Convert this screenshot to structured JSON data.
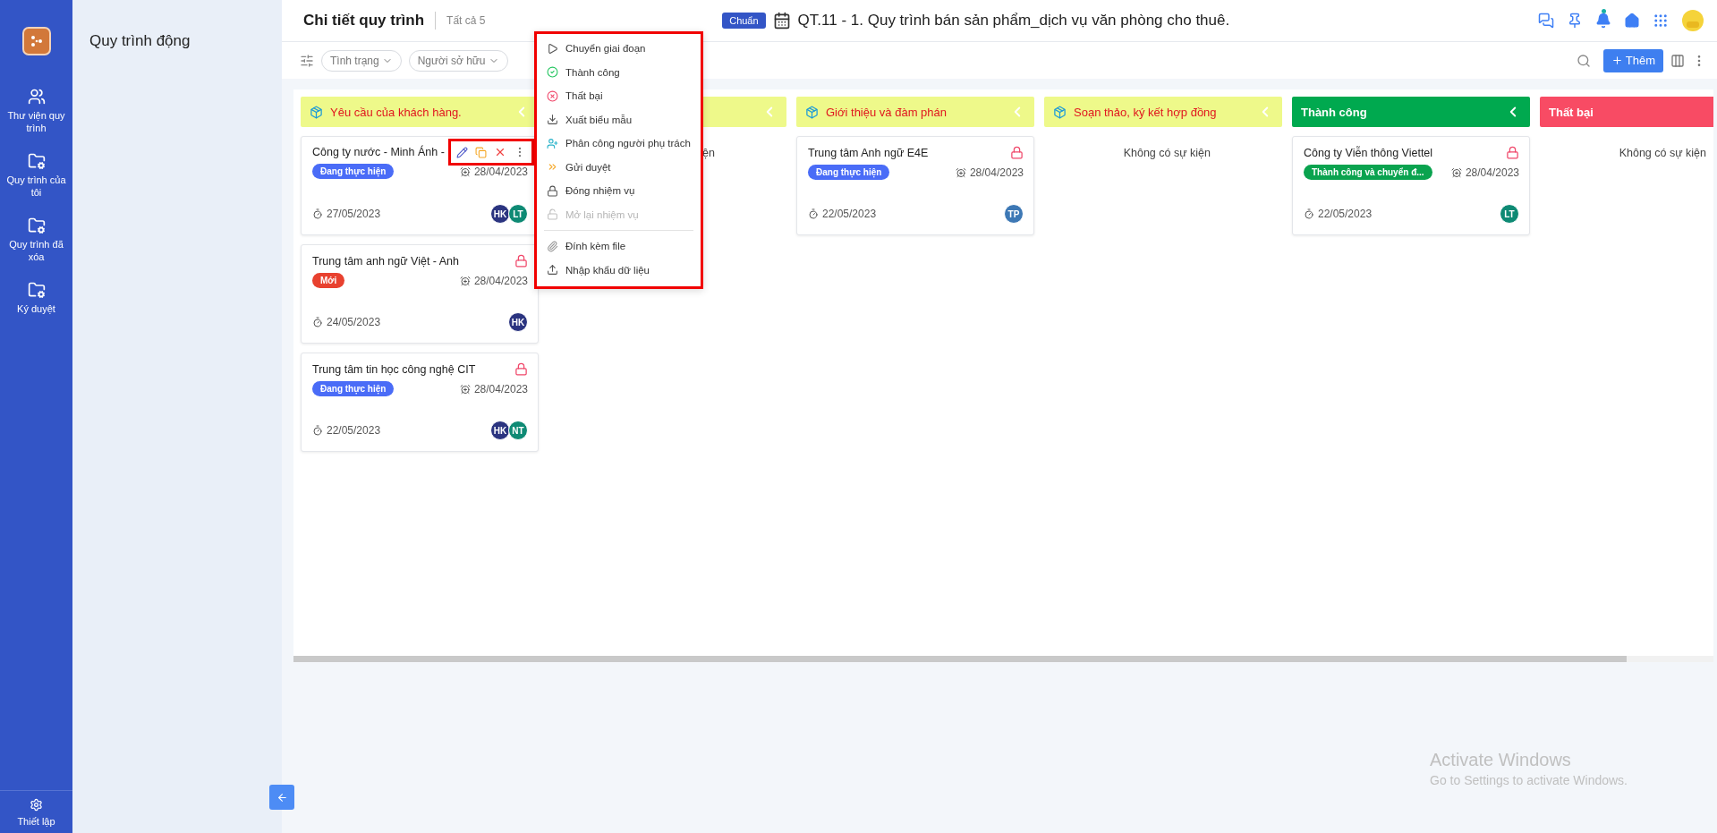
{
  "sidebar": {
    "items": [
      {
        "label": "Thư viện quy trình"
      },
      {
        "label": "Quy trình của tôi"
      },
      {
        "label": "Quy trình đã xóa"
      },
      {
        "label": "Ký duyệt"
      }
    ],
    "footer": {
      "label": "Thiết lập"
    }
  },
  "subpanel": {
    "title": "Quy trình động"
  },
  "header": {
    "title": "Chi tiết quy trình",
    "count": "Tất cả 5",
    "badge": "Chuẩn",
    "process_title": "QT.11 - 1. Quy trình bán sản phẩm_dịch vụ văn phòng cho thuê.",
    "notification_dot": true
  },
  "toolbar": {
    "filters": [
      {
        "label": "Tình trạng"
      },
      {
        "label": "Người sở hữu"
      }
    ],
    "add_button": "Thêm"
  },
  "columns": [
    {
      "kind": "stage",
      "title": "Yêu cầu của khách hàng.",
      "color": "#eef98a",
      "collapsible": true,
      "cards": [
        {
          "title": "Công ty nước - Minh Ánh -",
          "status": {
            "label": "Đang thực hiện",
            "color": "#4a6cf7"
          },
          "due": "28/04/2023",
          "deadline": "27/05/2023",
          "locked": false,
          "assignees": [
            {
              "initials": "HK",
              "color": "#2b3480"
            },
            {
              "initials": "LT",
              "color": "#0e8a74"
            }
          ],
          "actions": {
            "highlighted": true
          }
        },
        {
          "title": "Trung tâm anh ngữ Việt - Anh",
          "status": {
            "label": "Mới",
            "color": "#e8412f"
          },
          "due": "28/04/2023",
          "deadline": "24/05/2023",
          "locked": true,
          "assignees": [
            {
              "initials": "HK",
              "color": "#2b3480"
            }
          ]
        },
        {
          "title": "Trung tâm tin học công nghệ CIT",
          "status": {
            "label": "Đang thực hiện",
            "color": "#4a6cf7"
          },
          "due": "28/04/2023",
          "deadline": "22/05/2023",
          "locked": true,
          "assignees": [
            {
              "initials": "HK",
              "color": "#2b3480"
            },
            {
              "initials": "NT",
              "color": "#0e8a74"
            }
          ]
        }
      ]
    },
    {
      "kind": "stage",
      "color": "#eef98a",
      "collapsible": true,
      "empty_text": "ện"
    },
    {
      "kind": "stage",
      "title": "Giới thiệu và đàm phán",
      "color": "#eef98a",
      "collapsible": true,
      "cards": [
        {
          "title": "Trung tâm Anh ngữ E4E",
          "status": {
            "label": "Đang thực hiện",
            "color": "#4a6cf7"
          },
          "due": "28/04/2023",
          "deadline": "22/05/2023",
          "locked": true,
          "assignees": [
            {
              "initials": "TP",
              "color": "#3d78b5"
            }
          ]
        }
      ]
    },
    {
      "kind": "stage",
      "title": "Soạn thảo, ký kết hợp đồng",
      "color": "#eef98a",
      "collapsible": true,
      "empty_text": "Không có sự kiện"
    },
    {
      "kind": "result",
      "title": "Thành công",
      "color": "#00a94f",
      "collapsible": true,
      "cards": [
        {
          "title": "Công ty Viễn thông Viettel",
          "status": {
            "label": "Thành công và chuyển đ...",
            "color": "#0aa34f"
          },
          "due": "28/04/2023",
          "deadline": "22/05/2023",
          "locked": true,
          "assignees": [
            {
              "initials": "LT",
              "color": "#0e8a74"
            }
          ]
        }
      ]
    },
    {
      "kind": "result",
      "title": "Thất bại",
      "color": "#f84b64",
      "empty_text": "Không có sự kiện"
    }
  ],
  "context_menu": {
    "highlighted": true,
    "groups": [
      [
        {
          "label": "Chuyển giai đoạn",
          "disabled": false
        },
        {
          "label": "Thành công",
          "disabled": false
        },
        {
          "label": "Thất bại",
          "disabled": false
        },
        {
          "label": "Xuất biểu mẫu",
          "disabled": false
        },
        {
          "label": "Phân công người phụ trách",
          "disabled": false
        },
        {
          "label": "Gửi duyệt",
          "disabled": false
        },
        {
          "label": "Đóng nhiệm vụ",
          "disabled": false
        },
        {
          "label": "Mở lại nhiệm vụ",
          "disabled": true
        }
      ],
      [
        {
          "label": "Đính kèm file",
          "disabled": false
        },
        {
          "label": "Nhập khẩu dữ liệu",
          "disabled": false
        }
      ]
    ]
  },
  "os_notice": {
    "title": "Activate Windows",
    "subtitle": "Go to Settings to activate Windows."
  }
}
